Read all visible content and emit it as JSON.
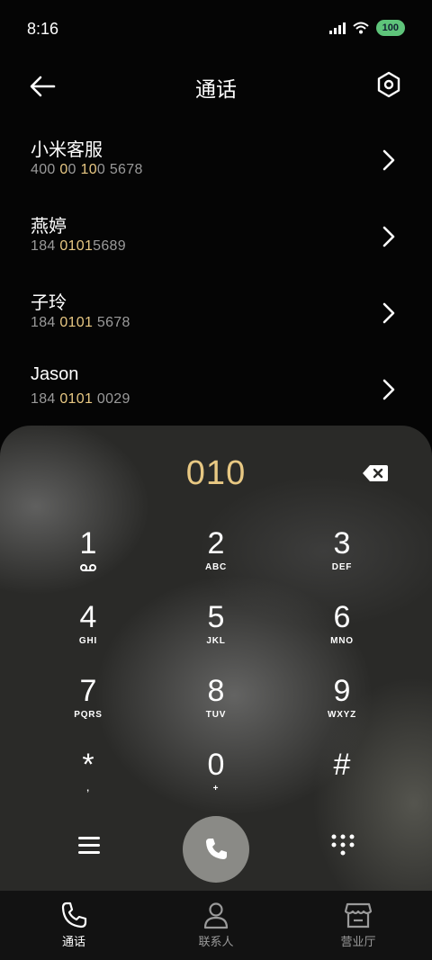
{
  "status_bar": {
    "time": "8:16",
    "battery": "100"
  },
  "header": {
    "title": "通话"
  },
  "results": [
    {
      "name": "小米客服",
      "num_pre": "400 ",
      "num_hl": "010",
      "num_post": "0 5678",
      "hl_alt": "10"
    },
    {
      "name": "燕婷",
      "num_pre": "184 ",
      "num_hl": "0101",
      "num_post": "5689"
    },
    {
      "name": "子玲",
      "num_pre": "184 ",
      "num_hl": "0101",
      "num_post": " 5678"
    },
    {
      "name": "Jason",
      "num_pre": "184 ",
      "num_hl": "0101",
      "num_post": " 0029"
    }
  ],
  "dialpad": {
    "entered": "010",
    "keys": [
      {
        "digit": "1",
        "letters": ""
      },
      {
        "digit": "2",
        "letters": "ABC"
      },
      {
        "digit": "3",
        "letters": "DEF"
      },
      {
        "digit": "4",
        "letters": "GHI"
      },
      {
        "digit": "5",
        "letters": "JKL"
      },
      {
        "digit": "6",
        "letters": "MNO"
      },
      {
        "digit": "7",
        "letters": "PQRS"
      },
      {
        "digit": "8",
        "letters": "TUV"
      },
      {
        "digit": "9",
        "letters": "WXYZ"
      },
      {
        "digit": "*",
        "letters": ","
      },
      {
        "digit": "0",
        "letters": "+"
      },
      {
        "digit": "#",
        "letters": ""
      }
    ]
  },
  "tabs": [
    {
      "label": "通话",
      "icon": "phone-icon",
      "active": true
    },
    {
      "label": "联系人",
      "icon": "person-icon",
      "active": false
    },
    {
      "label": "营业厅",
      "icon": "store-icon",
      "active": false
    }
  ],
  "colors": {
    "highlight": "#e8c883",
    "call_button": "#8a8a86"
  }
}
